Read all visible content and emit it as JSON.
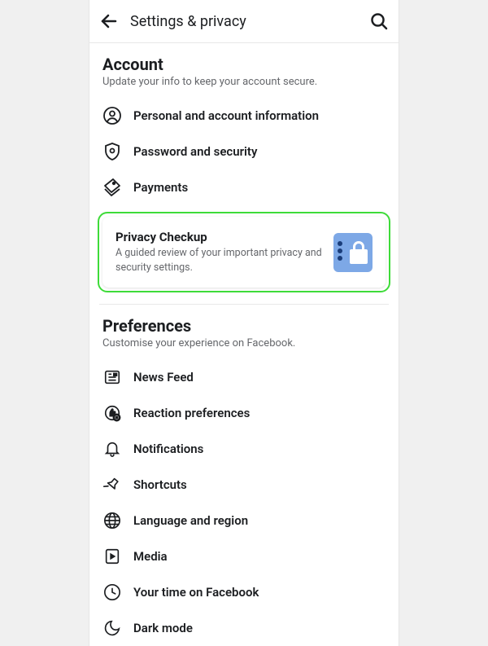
{
  "header": {
    "title": "Settings & privacy"
  },
  "sections": {
    "account": {
      "title": "Account",
      "subtitle": "Update your info to keep your account secure.",
      "items": [
        {
          "label": "Personal and account information"
        },
        {
          "label": "Password and security"
        },
        {
          "label": "Payments"
        }
      ]
    },
    "privacy_checkup": {
      "title": "Privacy Checkup",
      "subtitle": "A guided review of your important privacy and security settings."
    },
    "preferences": {
      "title": "Preferences",
      "subtitle": "Customise your experience on Facebook.",
      "items": [
        {
          "label": "News Feed"
        },
        {
          "label": "Reaction preferences"
        },
        {
          "label": "Notifications"
        },
        {
          "label": "Shortcuts"
        },
        {
          "label": "Language and region"
        },
        {
          "label": "Media"
        },
        {
          "label": "Your time on Facebook"
        },
        {
          "label": "Dark mode"
        }
      ]
    }
  }
}
